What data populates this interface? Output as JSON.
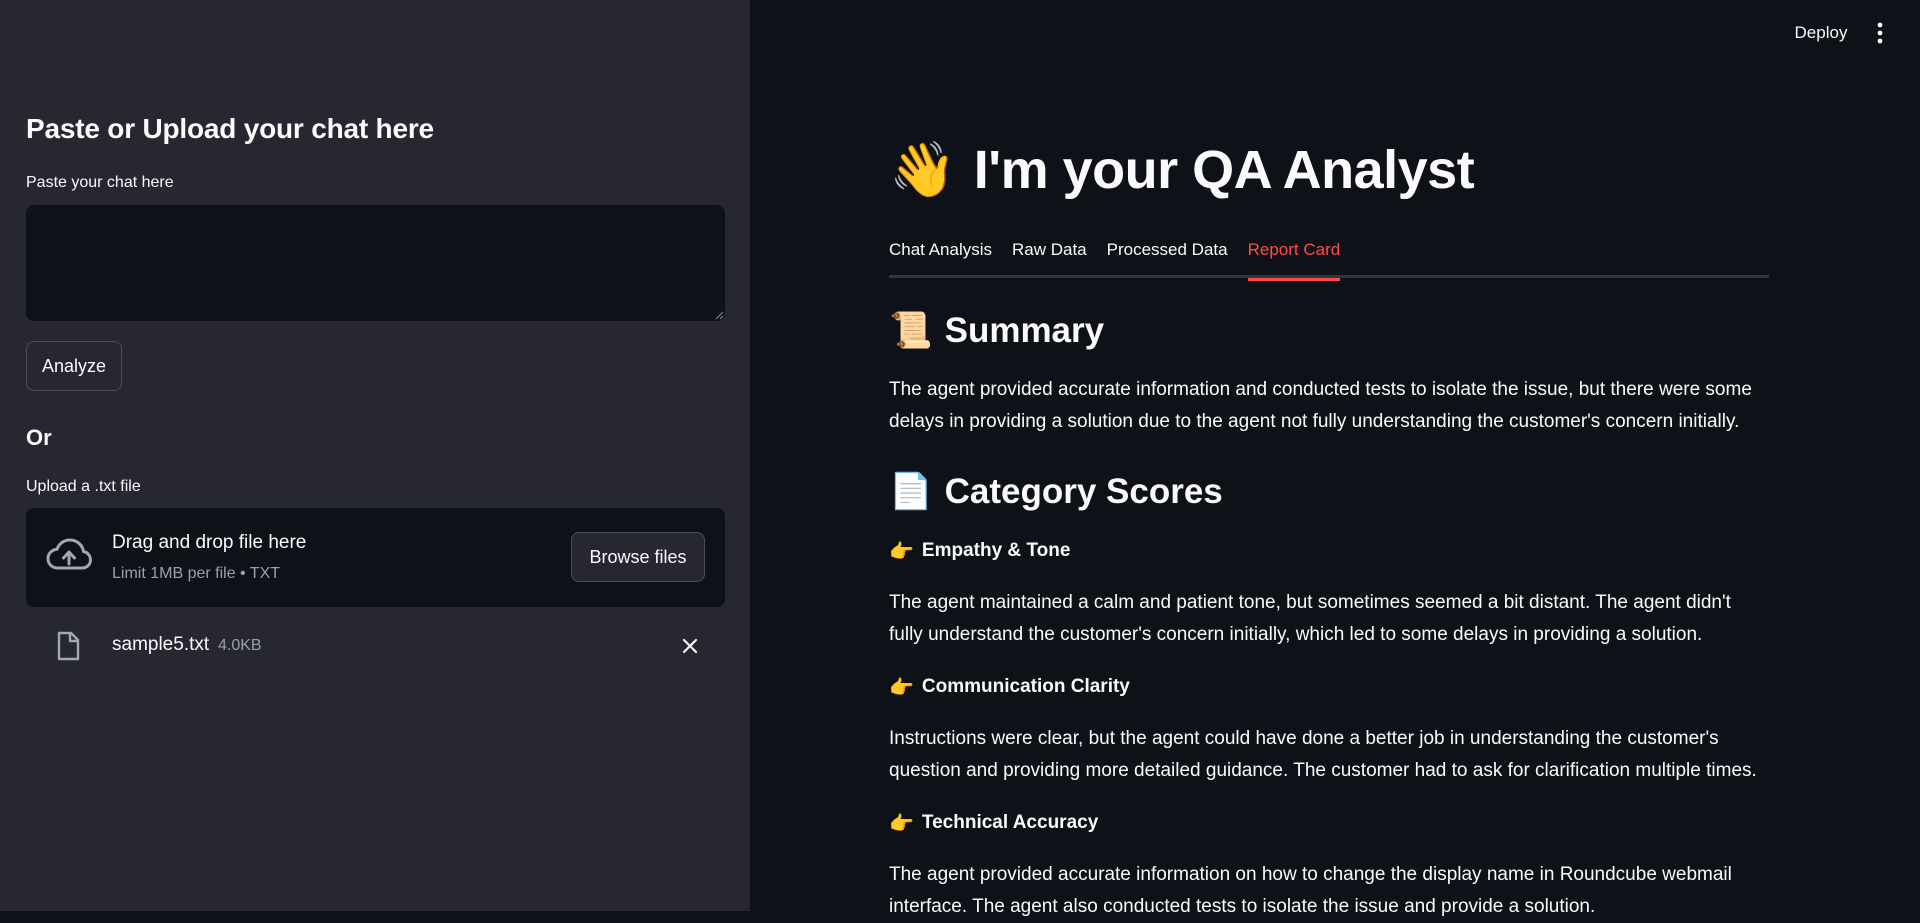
{
  "sidebar": {
    "title": "Paste or Upload your chat here",
    "paste_label": "Paste your chat here",
    "paste_value": "",
    "analyze_label": "Analyze",
    "or_label": "Or",
    "upload_label": "Upload a .txt file",
    "dropzone": {
      "title": "Drag and drop file here",
      "limit": "Limit 1MB per file • TXT",
      "browse_label": "Browse files"
    },
    "uploaded_file": {
      "name": "sample5.txt",
      "size": "4.0KB"
    }
  },
  "header": {
    "deploy_label": "Deploy",
    "menu_icon": "more-vertical-icon"
  },
  "main": {
    "title_emoji": "👋",
    "title": "I'm your QA Analyst",
    "tabs": [
      {
        "label": "Chat Analysis",
        "active": false
      },
      {
        "label": "Raw Data",
        "active": false
      },
      {
        "label": "Processed Data",
        "active": false
      },
      {
        "label": "Report Card",
        "active": true
      }
    ],
    "summary": {
      "emoji": "📜",
      "heading": "Summary",
      "text": "The agent provided accurate information and conducted tests to isolate the issue, but there were some delays in providing a solution due to the agent not fully understanding the customer's concern initially."
    },
    "category_scores": {
      "emoji": "📄",
      "heading": "Category Scores",
      "items": [
        {
          "emoji": "👉",
          "title": "Empathy & Tone",
          "text": "The agent maintained a calm and patient tone, but sometimes seemed a bit distant. The agent didn't fully understand the customer's concern initially, which led to some delays in providing a solution."
        },
        {
          "emoji": "👉",
          "title": "Communication Clarity",
          "text": "Instructions were clear, but the agent could have done a better job in understanding the customer's question and providing more detailed guidance. The customer had to ask for clarification multiple times."
        },
        {
          "emoji": "👉",
          "title": "Technical Accuracy",
          "text": "The agent provided accurate information on how to change the display name in Roundcube webmail interface. The agent also conducted tests to isolate the issue and provide a solution."
        }
      ]
    }
  },
  "colors": {
    "sidebar_bg": "#262730",
    "main_bg": "#0e1117",
    "accent": "#ff4b4b",
    "muted_text": "#9ba0a8"
  }
}
